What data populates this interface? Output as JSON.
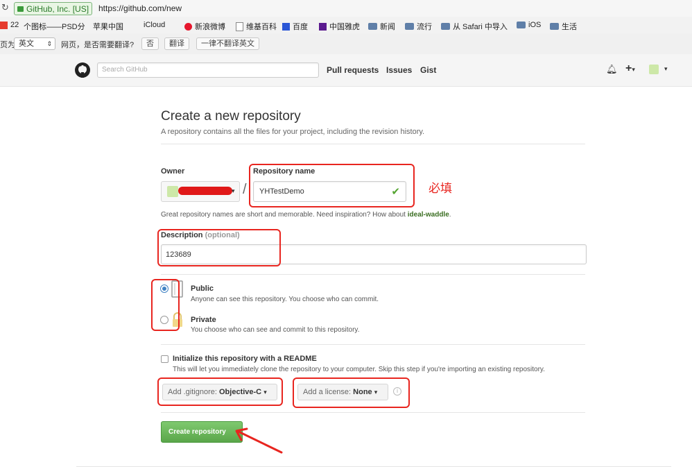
{
  "browser": {
    "site_badge": "GitHub, Inc. [US]",
    "url": "https://github.com/new",
    "bookmarks": [
      "22",
      "个图标——PSD分",
      "苹果中国",
      "iCloud",
      "新浪微博",
      "维基百科",
      "百度",
      "中国雅虎",
      "新闻",
      "流行",
      "从 Safari 中导入",
      "iOS",
      "生活"
    ]
  },
  "translate_bar": {
    "prefix": "页为",
    "language": "英文",
    "question": "网页，是否需要翻译?",
    "no": "否",
    "translate": "翻译",
    "never": "一律不翻译英文"
  },
  "header": {
    "search_placeholder": "Search GitHub",
    "nav": [
      "Pull requests",
      "Issues",
      "Gist"
    ]
  },
  "page": {
    "title": "Create a new repository",
    "subtitle": "A repository contains all the files for your project, including the revision history."
  },
  "form": {
    "owner_label": "Owner",
    "repo_label": "Repository name",
    "separator": "/",
    "repo_value": "YHTestDemo",
    "annotation": "必填",
    "hint_prefix": "Great repository names are short and memorable. Need inspiration? How about ",
    "hint_suggestion": "ideal-waddle",
    "hint_suffix": ".",
    "description_label": "Description",
    "description_optional": "(optional)",
    "description_value": "123689",
    "public_label": "Public",
    "public_desc": "Anyone can see this repository. You choose who can commit.",
    "private_label": "Private",
    "private_desc": "You choose who can see and commit to this repository.",
    "visibility_selected": "public",
    "readme_label": "Initialize this repository with a README",
    "readme_desc": "This will let you immediately clone the repository to your computer. Skip this step if you're importing an existing repository.",
    "gitignore_prefix": "Add .gitignore:",
    "gitignore_value": "Objective-C",
    "license_prefix": "Add a license:",
    "license_value": "None",
    "submit": "Create repository"
  },
  "colors": {
    "annotation_red": "#e8251f",
    "success_green": "#55a532",
    "radio_blue": "#4183c4",
    "link_green": "#3b6e22"
  }
}
